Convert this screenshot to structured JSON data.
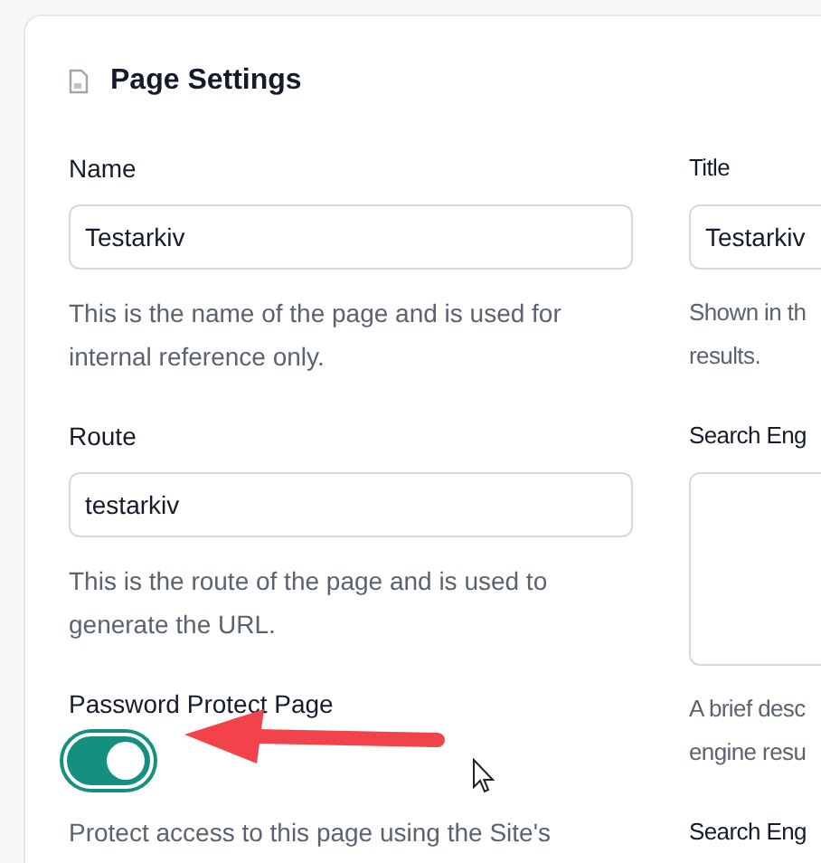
{
  "panel": {
    "title": "Page Settings"
  },
  "left_fields": [
    {
      "kind": "text",
      "label": "Name",
      "value": "Testarkiv",
      "help": "This is the name of the page and is used for internal reference only."
    },
    {
      "kind": "text",
      "label": "Route",
      "value": "testarkiv",
      "help": "This is the route of the page and is used to generate the URL."
    },
    {
      "kind": "toggle",
      "label": "Password Protect Page",
      "on": true,
      "help": "Protect access to this page using the Site's"
    }
  ],
  "right_fields": [
    {
      "kind": "text",
      "label": "Title",
      "value": "Testarkiv",
      "help_lines": [
        "Shown in th",
        "results."
      ]
    },
    {
      "kind": "textarea",
      "label": "Search Eng",
      "help_lines": [
        "A brief desc",
        "engine resu"
      ]
    },
    {
      "kind": "label",
      "label": "Search Eng"
    }
  ]
}
